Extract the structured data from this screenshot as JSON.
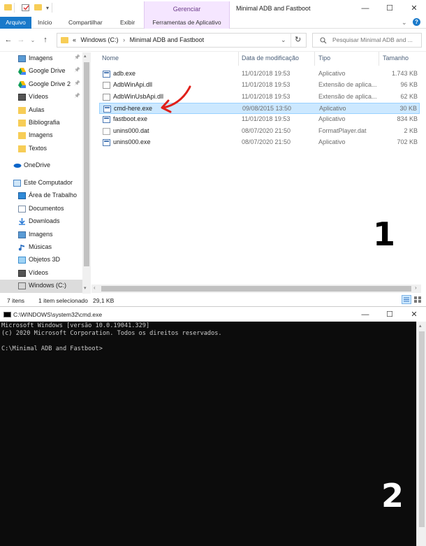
{
  "explorer": {
    "ribbon_context_group": "Gerenciar",
    "window_title": "Minimal ADB and Fastboot",
    "tabs": [
      "Arquivo",
      "Início",
      "Compartilhar",
      "Exibir",
      "Ferramentas de Aplicativo"
    ],
    "address_parts": [
      "«",
      "Windows (C:)",
      "›",
      "Minimal ADB and Fastboot"
    ],
    "search_placeholder": "Pesquisar Minimal ADB and ...",
    "sidebar": [
      {
        "label": "Imagens",
        "icon": "pictures-icon",
        "pinned": true
      },
      {
        "label": "Google Drive",
        "icon": "google-drive-icon",
        "pinned": true
      },
      {
        "label": "Google Drive 2",
        "icon": "google-drive-icon",
        "pinned": true
      },
      {
        "label": "Vídeos",
        "icon": "videos-icon",
        "pinned": true
      },
      {
        "label": "Aulas",
        "icon": "folder-icon",
        "pinned": false
      },
      {
        "label": "Bibliografia",
        "icon": "folder-icon",
        "pinned": false
      },
      {
        "label": "Imagens",
        "icon": "folder-icon",
        "pinned": false
      },
      {
        "label": "Textos",
        "icon": "folder-icon",
        "pinned": false
      },
      {
        "label": "OneDrive",
        "icon": "onedrive-icon",
        "pinned": false
      },
      {
        "label": "Este Computador",
        "icon": "computer-icon",
        "pinned": false
      },
      {
        "label": "Área de Trabalho",
        "icon": "desktop-icon",
        "pinned": false
      },
      {
        "label": "Documentos",
        "icon": "documents-icon",
        "pinned": false
      },
      {
        "label": "Downloads",
        "icon": "downloads-icon",
        "pinned": false
      },
      {
        "label": "Imagens",
        "icon": "pictures-icon",
        "pinned": false
      },
      {
        "label": "Músicas",
        "icon": "music-icon",
        "pinned": false
      },
      {
        "label": "Objetos 3D",
        "icon": "3d-objects-icon",
        "pinned": false
      },
      {
        "label": "Vídeos",
        "icon": "videos-icon",
        "pinned": false
      },
      {
        "label": "Windows (C:)",
        "icon": "drive-icon",
        "pinned": false
      }
    ],
    "columns": [
      "Nome",
      "Data de modificação",
      "Tipo",
      "Tamanho"
    ],
    "files": [
      {
        "name": "adb.exe",
        "date": "11/01/2018 19:53",
        "type": "Aplicativo",
        "size": "1.743 KB",
        "icon": "exe-icon"
      },
      {
        "name": "AdbWinApi.dll",
        "date": "11/01/2018 19:53",
        "type": "Extensão de aplica...",
        "size": "96 KB",
        "icon": "dll-icon"
      },
      {
        "name": "AdbWinUsbApi.dll",
        "date": "11/01/2018 19:53",
        "type": "Extensão de aplica...",
        "size": "62 KB",
        "icon": "dll-icon"
      },
      {
        "name": "cmd-here.exe",
        "date": "09/08/2015 13:50",
        "type": "Aplicativo",
        "size": "30 KB",
        "icon": "exe-icon",
        "selected": true
      },
      {
        "name": "fastboot.exe",
        "date": "11/01/2018 19:53",
        "type": "Aplicativo",
        "size": "834 KB",
        "icon": "exe-icon"
      },
      {
        "name": "unins000.dat",
        "date": "08/07/2020 21:50",
        "type": "FormatPlayer.dat",
        "size": "2 KB",
        "icon": "dat-icon"
      },
      {
        "name": "unins000.exe",
        "date": "08/07/2020 21:50",
        "type": "Aplicativo",
        "size": "702 KB",
        "icon": "exe-icon"
      }
    ],
    "status": {
      "items": "7 itens",
      "selected": "1 item selecionado",
      "size": "29,1 KB"
    },
    "step_number": "1"
  },
  "cmd": {
    "title": "C:\\WINDOWS\\system32\\cmd.exe",
    "lines": [
      "Microsoft Windows [versão 10.0.19041.329]",
      "(c) 2020 Microsoft Corporation. Todos os direitos reservados.",
      "",
      "C:\\Minimal ADB and Fastboot>"
    ],
    "step_number": "2"
  },
  "colors": {
    "file_tab": "#1979ca",
    "context_tab": "#f5e6ff",
    "selection": "#cce8ff",
    "arrow": "#e0201a",
    "console_bg": "#0c0c0c"
  }
}
